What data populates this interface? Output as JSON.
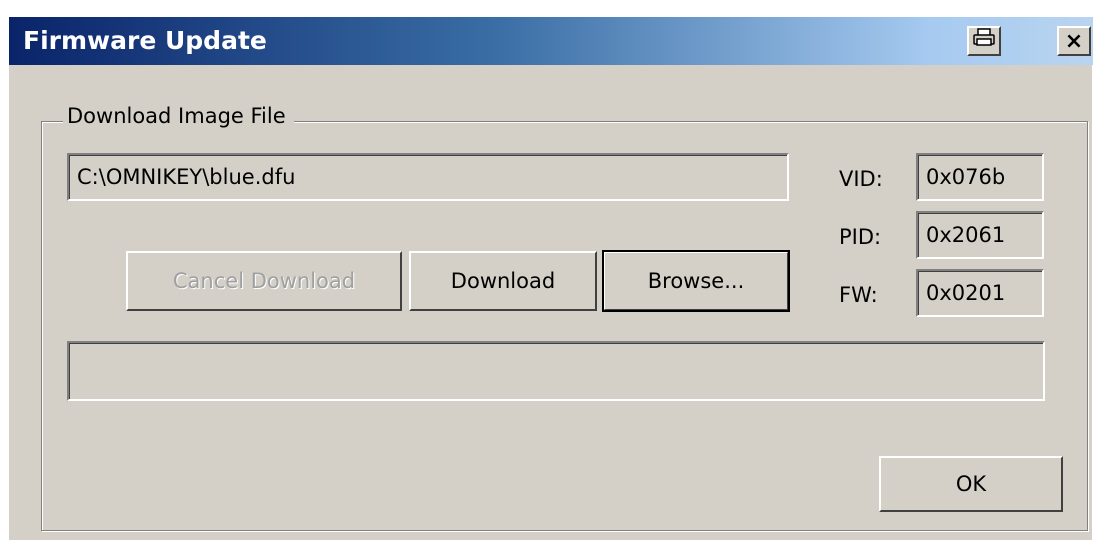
{
  "window": {
    "title": "Firmware Update",
    "print_icon": "print-icon",
    "close_label": "×"
  },
  "group": {
    "label": "Download Image File"
  },
  "file_path": {
    "value": "C:\\OMNIKEY\\blue.dfu"
  },
  "device": {
    "vid_label": "VID:",
    "vid_value": "0x076b",
    "pid_label": "PID:",
    "pid_value": "0x2061",
    "fw_label": "FW:",
    "fw_value": "0x0201"
  },
  "buttons": {
    "cancel_download": "Cancel Download",
    "download": "Download",
    "browse": "Browse...",
    "ok": "OK"
  },
  "progress": {
    "value": 0
  }
}
